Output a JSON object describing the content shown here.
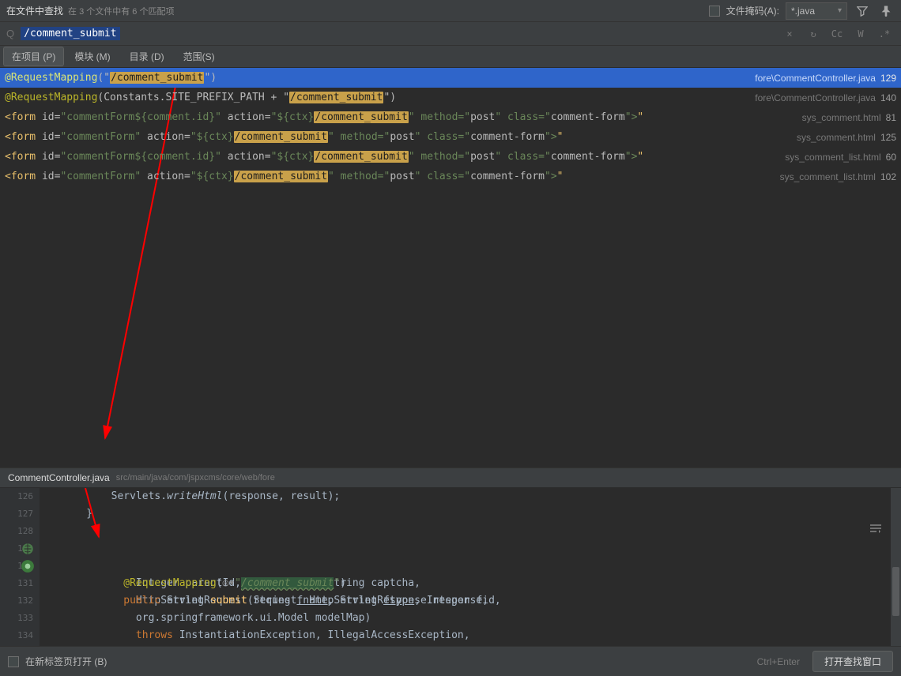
{
  "topbar": {
    "title": "在文件中查找",
    "subtitle": "在 3 个文件中有 6 个匹配项",
    "mask_label": "文件掩码(A):",
    "mask_value": "*.java"
  },
  "search": {
    "query": "/comment_submit",
    "opt_cc": "Cc",
    "opt_w": "W",
    "opt_regex": ".*"
  },
  "tabs": {
    "t0": "在项目 (P)",
    "t1": "模块 (M)",
    "t2": "目录 (D)",
    "t3": "范围(S)"
  },
  "results": [
    {
      "selected": true,
      "pre": "@RequestMapping(\"",
      "match": "/comment_submit",
      "post": "\")",
      "type": "anno",
      "file": "fore\\CommentController.java",
      "line": "129"
    },
    {
      "selected": false,
      "pre": "@RequestMapping(Constants.SITE_PREFIX_PATH + \"",
      "match": "/comment_submit",
      "post": "\")",
      "type": "anno",
      "file": "fore\\CommentController.java",
      "line": "140"
    },
    {
      "selected": false,
      "pre": "<form id=\"commentForm${comment.id}\" action=\"${ctx}",
      "match": "/comment_submit",
      "post": "\" method=\"post\" class=\"comment-form\">",
      "type": "html",
      "file": "sys_comment.html",
      "line": "81"
    },
    {
      "selected": false,
      "pre": "<form id=\"commentForm\" action=\"${ctx}",
      "match": "/comment_submit",
      "post": "\" method=\"post\" class=\"comment-form\">",
      "type": "html",
      "file": "sys_comment.html",
      "line": "125"
    },
    {
      "selected": false,
      "pre": "<form id=\"commentForm${comment.id}\" action=\"${ctx}",
      "match": "/comment_submit",
      "post": "\" method=\"post\" class=\"comment-form\">",
      "type": "html",
      "file": "sys_comment_list.html",
      "line": "60"
    },
    {
      "selected": false,
      "pre": "<form id=\"commentForm\" action=\"${ctx}",
      "match": "/comment_submit",
      "post": "\" method=\"post\" class=\"comment-form\">",
      "type": "html",
      "file": "sys_comment_list.html",
      "line": "102"
    }
  ],
  "preview": {
    "filename": "CommentController.java",
    "path": "src/main/java/com/jspxcms/core/web/fore",
    "lines": {
      "126": "126",
      "127": "127",
      "128": "128",
      "129": "129",
      "130": "130",
      "131": "131",
      "132": "132",
      "133": "133",
      "134": "134"
    },
    "code": {
      "l126_a": "        Servlets.",
      "l126_b": "writeHtml",
      "l126_c": "(response, result);",
      "l127": "    }",
      "l128": "",
      "l129_a": "    @RequestMapping",
      "l129_b": "(",
      "l129_c": "\"",
      "l129_d": "/comment_submit",
      "l129_e": "\"",
      "l129_f": ")",
      "l130_a": "    public ",
      "l130_b": "String ",
      "l130_c": "submit",
      "l130_d": "(String ",
      "l130_e": "fname",
      "l130_f": ", String ",
      "l130_g": "ftype",
      "l130_h": ", Integer fid,",
      "l131": "            Integer parentId, String text, String captcha,",
      "l132": "            HttpServletRequest request, HttpServletResponse response,",
      "l133": "            org.springframework.ui.Model modelMap)",
      "l134_a": "            throws ",
      "l134_b": "InstantiationException, IllegalAccessException,"
    }
  },
  "footer": {
    "newtab": "在新标签页打开 (B)",
    "shortcut": "Ctrl+Enter",
    "button": "打开查找窗口"
  }
}
